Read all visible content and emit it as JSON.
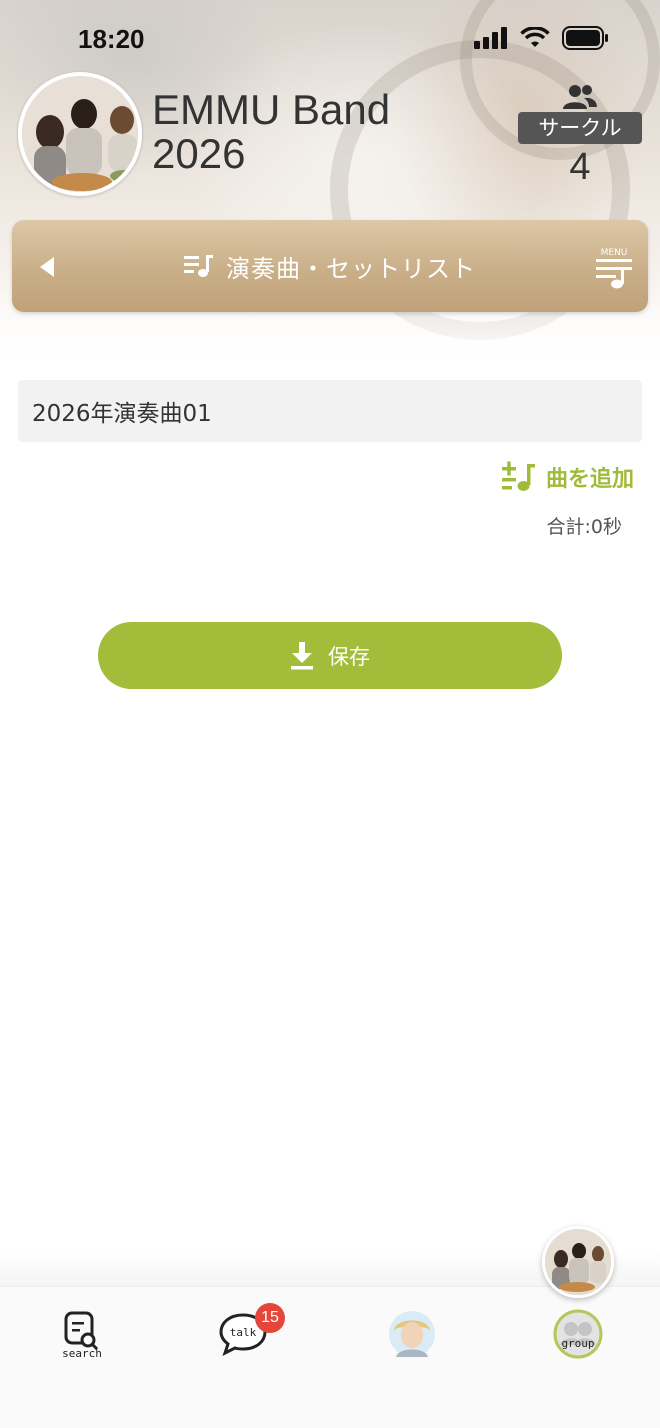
{
  "status": {
    "time": "18:20"
  },
  "group": {
    "title_line1": "EMMU Band",
    "title_line2": "2026",
    "type_badge": "サークル",
    "member_count": "4"
  },
  "section": {
    "title": "演奏曲・セットリスト",
    "menu_label": "MENU"
  },
  "setlist": {
    "name_value": "2026年演奏曲01",
    "add_song_label": "曲を追加",
    "total_label": "合計:0秒"
  },
  "actions": {
    "save_label": "保存"
  },
  "nav": {
    "items": [
      {
        "label": "search",
        "icon": "search-icon"
      },
      {
        "label": "talk",
        "icon": "talk-icon",
        "badge": "15"
      },
      {
        "label": "",
        "icon": "profile-avatar"
      },
      {
        "label": "group",
        "icon": "group-icon"
      }
    ]
  },
  "colors": {
    "accent_green": "#a3bd3b",
    "section_bar": "#c8ad86",
    "badge_red": "#e4473a",
    "member_badge": "#555555"
  }
}
